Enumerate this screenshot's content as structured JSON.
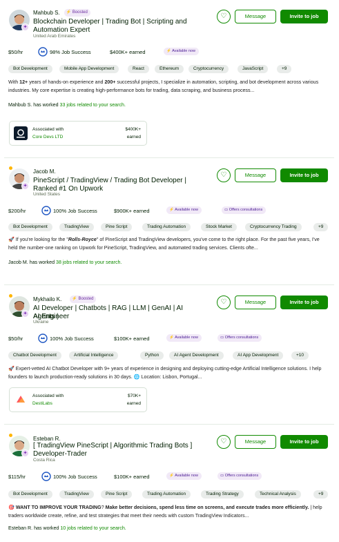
{
  "freelancers": [
    {
      "name": "Mahbub S.",
      "boosted": "Boosted",
      "title_lines": [
        "Blockchain Developer | Trading Bot | Scripting and",
        "Automation Expert"
      ],
      "location": "United Arab Emirates",
      "rate": "$50/hr",
      "job_success": "98% Job Success",
      "earned": "$400K+ earned",
      "availability": "Available now",
      "consultations": "",
      "skills": [
        "Bot Development",
        "Mobile App Development",
        "React",
        "Ethereum",
        "Cryptocurrency",
        "JavaScript",
        "+9"
      ],
      "description": [
        {
          "t": "With "
        },
        {
          "t": "12+",
          "b": true
        },
        {
          "t": " years of hands-on experience and "
        },
        {
          "t": "200+",
          "b": true
        },
        {
          "t": " successful projects, I specialize in automation, scripting, and bot development across various industries. My core expertise is creating high-performance bots for trading, data scraping, and business process..."
        }
      ],
      "worked_prefix": "Mahbub S. has worked ",
      "worked_link": "33 jobs related to your search.",
      "agency": {
        "assoc": "Associated with",
        "name": "Core Devs LTD",
        "earn1": "$400K+",
        "earn2": "earned"
      },
      "online": false
    },
    {
      "name": "Jacob M.",
      "boosted": "",
      "title_lines": [
        "PineScript / TradingView / Trading Bot Developer |",
        "Ranked #1 On Upwork"
      ],
      "location": "United States",
      "rate": "$200/hr",
      "job_success": "100% Job Success",
      "earned": "$900K+ earned",
      "availability": "Available now",
      "consultations": "Offers consultations",
      "skills": [
        "Bot Development",
        "TradingView",
        "Pine Script",
        "Trading Automation",
        "Stock Market",
        "Cryptocurrency Trading",
        "+9"
      ],
      "description": [
        {
          "t": "🚀 If you're looking for the \""
        },
        {
          "t": "Rolls-Royce",
          "i": true
        },
        {
          "t": "\" of PineScript and TradingView developers, you've come to the right place. For the past five years, I've held the number-one ranking on Upwork for PineScript, TradingView, and automated trading services. Clients ofte..."
        }
      ],
      "worked_prefix": "Jacob M. has worked ",
      "worked_link": "38 jobs related to your search.",
      "agency": null,
      "online": true
    },
    {
      "name": "Mykhailo K.",
      "boosted": "Boosted",
      "title_lines": [
        "AI Developer | Chatbots | RAG | LLM | GenAI | AI Agents |",
        "AI Engineer"
      ],
      "location": "Ukraine",
      "rate": "$50/hr",
      "job_success": "100% Job Success",
      "earned": "$100K+ earned",
      "availability": "Available now",
      "consultations": "Offers consultations",
      "skills": [
        "Chatbot Development",
        "Artificial Intelligence",
        "Python",
        "AI Agent Development",
        "AI App Development",
        "+10"
      ],
      "description": [
        {
          "t": "🚀 Expert-vetted AI Chatbot Developer with 9+ years of experience in designing and deploying cutting-edge Artificial Intelligence solutions. I help founders to launch production-ready solutions in 30 days. 🌐 Location: Lisbon, Portugal..."
        }
      ],
      "worked_prefix": "",
      "worked_link": "",
      "agency": {
        "assoc": "Associated with",
        "name": "DestiLabs",
        "earn1": "$70K+",
        "earn2": "earned"
      },
      "online": true
    },
    {
      "name": "Esteban R.",
      "boosted": "",
      "title_lines": [
        "[ TradingView PineScript | Algorithmic Trading Bots ]",
        "Developer-Trader"
      ],
      "location": "Costa Rica",
      "rate": "$115/hr",
      "job_success": "100% Job Success",
      "earned": "$100K+ earned",
      "availability": "Available now",
      "consultations": "Offers consultations",
      "skills": [
        "Bot Development",
        "TradingView",
        "Pine Script",
        "Trading Automation",
        "Trading Strategy",
        "Technical Analysis",
        "+9"
      ],
      "description": [
        {
          "t": "🎯 "
        },
        {
          "t": "WANT TO IMPROVE YOUR TRADING",
          "b": true
        },
        {
          "t": "? "
        },
        {
          "t": "Make better decisions, spend less time on screens, and execute trades more efficiently.",
          "b": true
        },
        {
          "t": " | help traders worldwide create, refine, and test strategies that meet their needs with custom TradingView Indicators..."
        }
      ],
      "worked_prefix": "Esteban R. has worked ",
      "worked_link": "10 jobs related to your search.",
      "agency": null,
      "online": true
    }
  ],
  "buttons": {
    "message": "Message",
    "invite": "Invite to job"
  },
  "icons": {
    "heart": "heart-icon",
    "bolt": "lightning-icon",
    "video": "video-icon",
    "jss": "job-success-badge-icon",
    "rising": "rising-talent-icon"
  },
  "colors": {
    "accent": "#108a00",
    "boost": "#6b2da1",
    "online": "#ffb600"
  }
}
